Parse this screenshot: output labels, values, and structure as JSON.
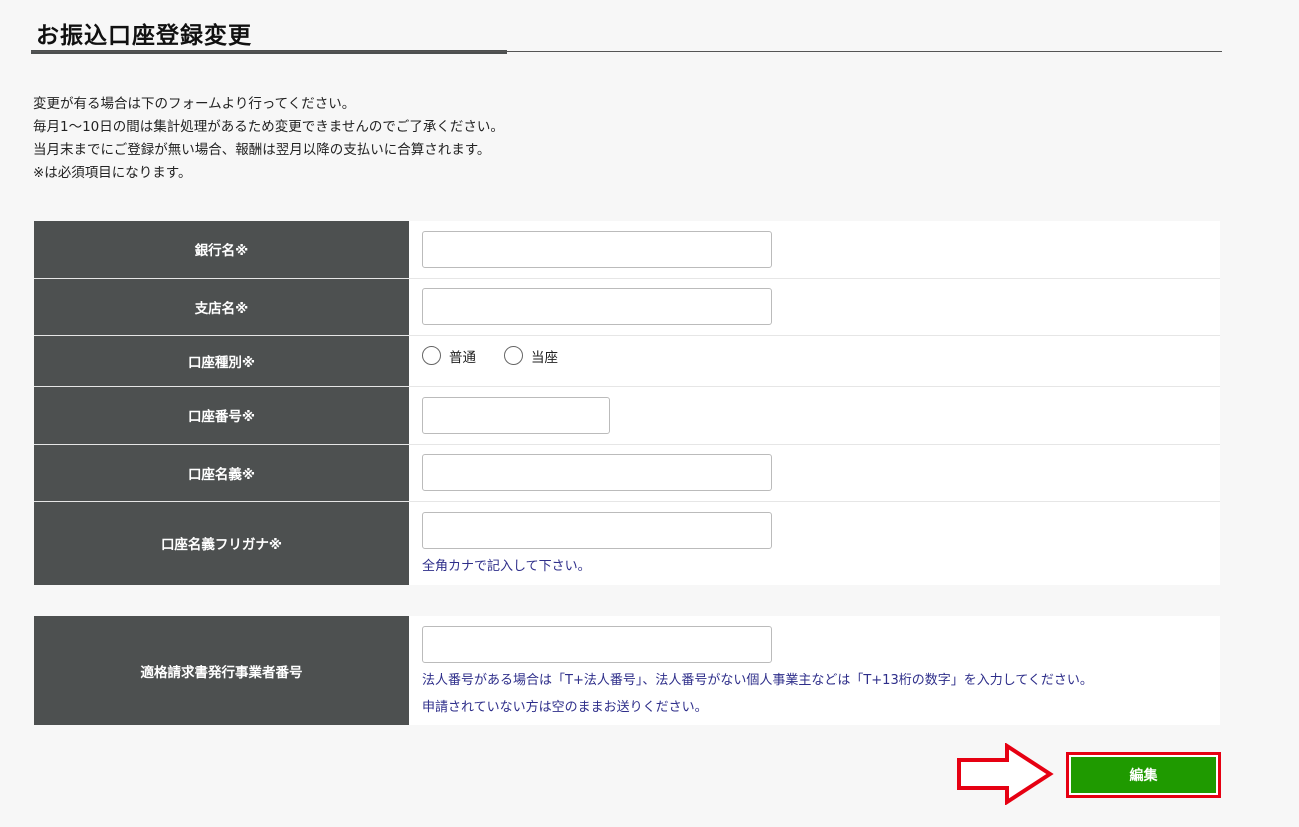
{
  "page": {
    "title": "お振込口座登録変更"
  },
  "intro": {
    "lines": [
      "変更が有る場合は下のフォームより行ってください。",
      "毎月1～10日の間は集計処理があるため変更できませんのでご了承ください。",
      "当月末までにご登録が無い場合、報酬は翌月以降の支払いに合算されます。",
      "※は必須項目になります。"
    ]
  },
  "form": {
    "bank_name": {
      "label": "銀行名※",
      "value": ""
    },
    "branch_name": {
      "label": "支店名※",
      "value": ""
    },
    "account_type": {
      "label": "口座種別※",
      "options": [
        "普通",
        "当座"
      ]
    },
    "account_number": {
      "label": "口座番号※",
      "value": ""
    },
    "account_holder": {
      "label": "口座名義※",
      "value": ""
    },
    "account_holder_kana": {
      "label": "口座名義フリガナ※",
      "value": "",
      "note": "全角カナで記入して下さい。"
    },
    "invoice_number": {
      "label": "適格請求書発行事業者番号",
      "value": "",
      "note1": "法人番号がある場合は「T+法人番号」、法人番号がない個人事業主などは「T+13桁の数字」を入力してください。",
      "note2": "申請されていない方は空のままお送りください。"
    }
  },
  "actions": {
    "edit_label": "編集"
  },
  "colors": {
    "header_cell": "#4d5050",
    "button_green": "#1f9a00",
    "highlight_red": "#e60012",
    "note_text": "#2e2e8a"
  }
}
